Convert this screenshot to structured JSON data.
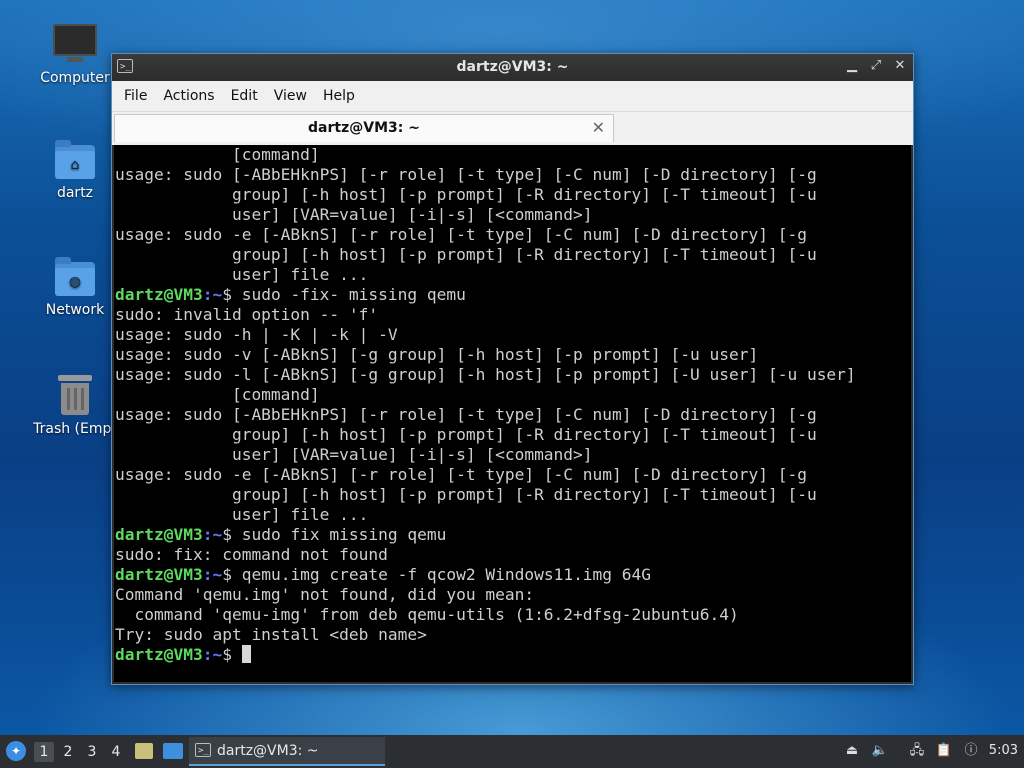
{
  "desktop": {
    "icons": [
      {
        "label": "Computer",
        "icon": "monitor-icon"
      },
      {
        "label": "dartz",
        "icon": "home-folder-icon"
      },
      {
        "label": "Network",
        "icon": "network-folder-icon"
      },
      {
        "label": "Trash (Empt",
        "icon": "trash-icon"
      }
    ]
  },
  "window": {
    "title": "dartz@VM3: ~",
    "controls": {
      "minimize": "▁",
      "maximize": "⤢",
      "close": "✕"
    },
    "menu": [
      "File",
      "Actions",
      "Edit",
      "View",
      "Help"
    ],
    "tab": {
      "label": "dartz@VM3: ~",
      "close": "✕"
    }
  },
  "terminal": {
    "prompt_user": "dartz@VM3",
    "prompt_path": ":~",
    "lines": [
      {
        "type": "out",
        "text": "            [command]"
      },
      {
        "type": "out",
        "text": "usage: sudo [-ABbEHknPS] [-r role] [-t type] [-C num] [-D directory] [-g"
      },
      {
        "type": "out",
        "text": "            group] [-h host] [-p prompt] [-R directory] [-T timeout] [-u"
      },
      {
        "type": "out",
        "text": "            user] [VAR=value] [-i|-s] [<command>]"
      },
      {
        "type": "out",
        "text": "usage: sudo -e [-ABknS] [-r role] [-t type] [-C num] [-D directory] [-g"
      },
      {
        "type": "out",
        "text": "            group] [-h host] [-p prompt] [-R directory] [-T timeout] [-u"
      },
      {
        "type": "out",
        "text": "            user] file ..."
      },
      {
        "type": "cmd",
        "text": "$ sudo -fix- missing qemu"
      },
      {
        "type": "out",
        "text": "sudo: invalid option -- 'f'"
      },
      {
        "type": "out",
        "text": "usage: sudo -h | -K | -k | -V"
      },
      {
        "type": "out",
        "text": "usage: sudo -v [-ABknS] [-g group] [-h host] [-p prompt] [-u user]"
      },
      {
        "type": "out",
        "text": "usage: sudo -l [-ABknS] [-g group] [-h host] [-p prompt] [-U user] [-u user]"
      },
      {
        "type": "out",
        "text": "            [command]"
      },
      {
        "type": "out",
        "text": "usage: sudo [-ABbEHknPS] [-r role] [-t type] [-C num] [-D directory] [-g"
      },
      {
        "type": "out",
        "text": "            group] [-h host] [-p prompt] [-R directory] [-T timeout] [-u"
      },
      {
        "type": "out",
        "text": "            user] [VAR=value] [-i|-s] [<command>]"
      },
      {
        "type": "out",
        "text": "usage: sudo -e [-ABknS] [-r role] [-t type] [-C num] [-D directory] [-g"
      },
      {
        "type": "out",
        "text": "            group] [-h host] [-p prompt] [-R directory] [-T timeout] [-u"
      },
      {
        "type": "out",
        "text": "            user] file ..."
      },
      {
        "type": "cmd",
        "text": "$ sudo fix missing qemu"
      },
      {
        "type": "out",
        "text": "sudo: fix: command not found"
      },
      {
        "type": "cmd",
        "text": "$ qemu.img create -f qcow2 Windows11.img 64G"
      },
      {
        "type": "out",
        "text": "Command 'qemu.img' not found, did you mean:"
      },
      {
        "type": "out",
        "text": "  command 'qemu-img' from deb qemu-utils (1:6.2+dfsg-2ubuntu6.4)"
      },
      {
        "type": "out",
        "text": "Try: sudo apt install <deb name>"
      },
      {
        "type": "cmd",
        "text": "$ ",
        "cursor": true
      }
    ]
  },
  "taskbar": {
    "start_icon": "lubuntu-logo-icon",
    "workspaces": [
      "1",
      "2",
      "3",
      "4"
    ],
    "active_workspace": "1",
    "task_label": "dartz@VM3: ~",
    "tray_icons": [
      "eject-icon",
      "volume-icon",
      "network-icon",
      "clipboard-icon",
      "update-notifier-icon"
    ],
    "clock": "5:03"
  }
}
